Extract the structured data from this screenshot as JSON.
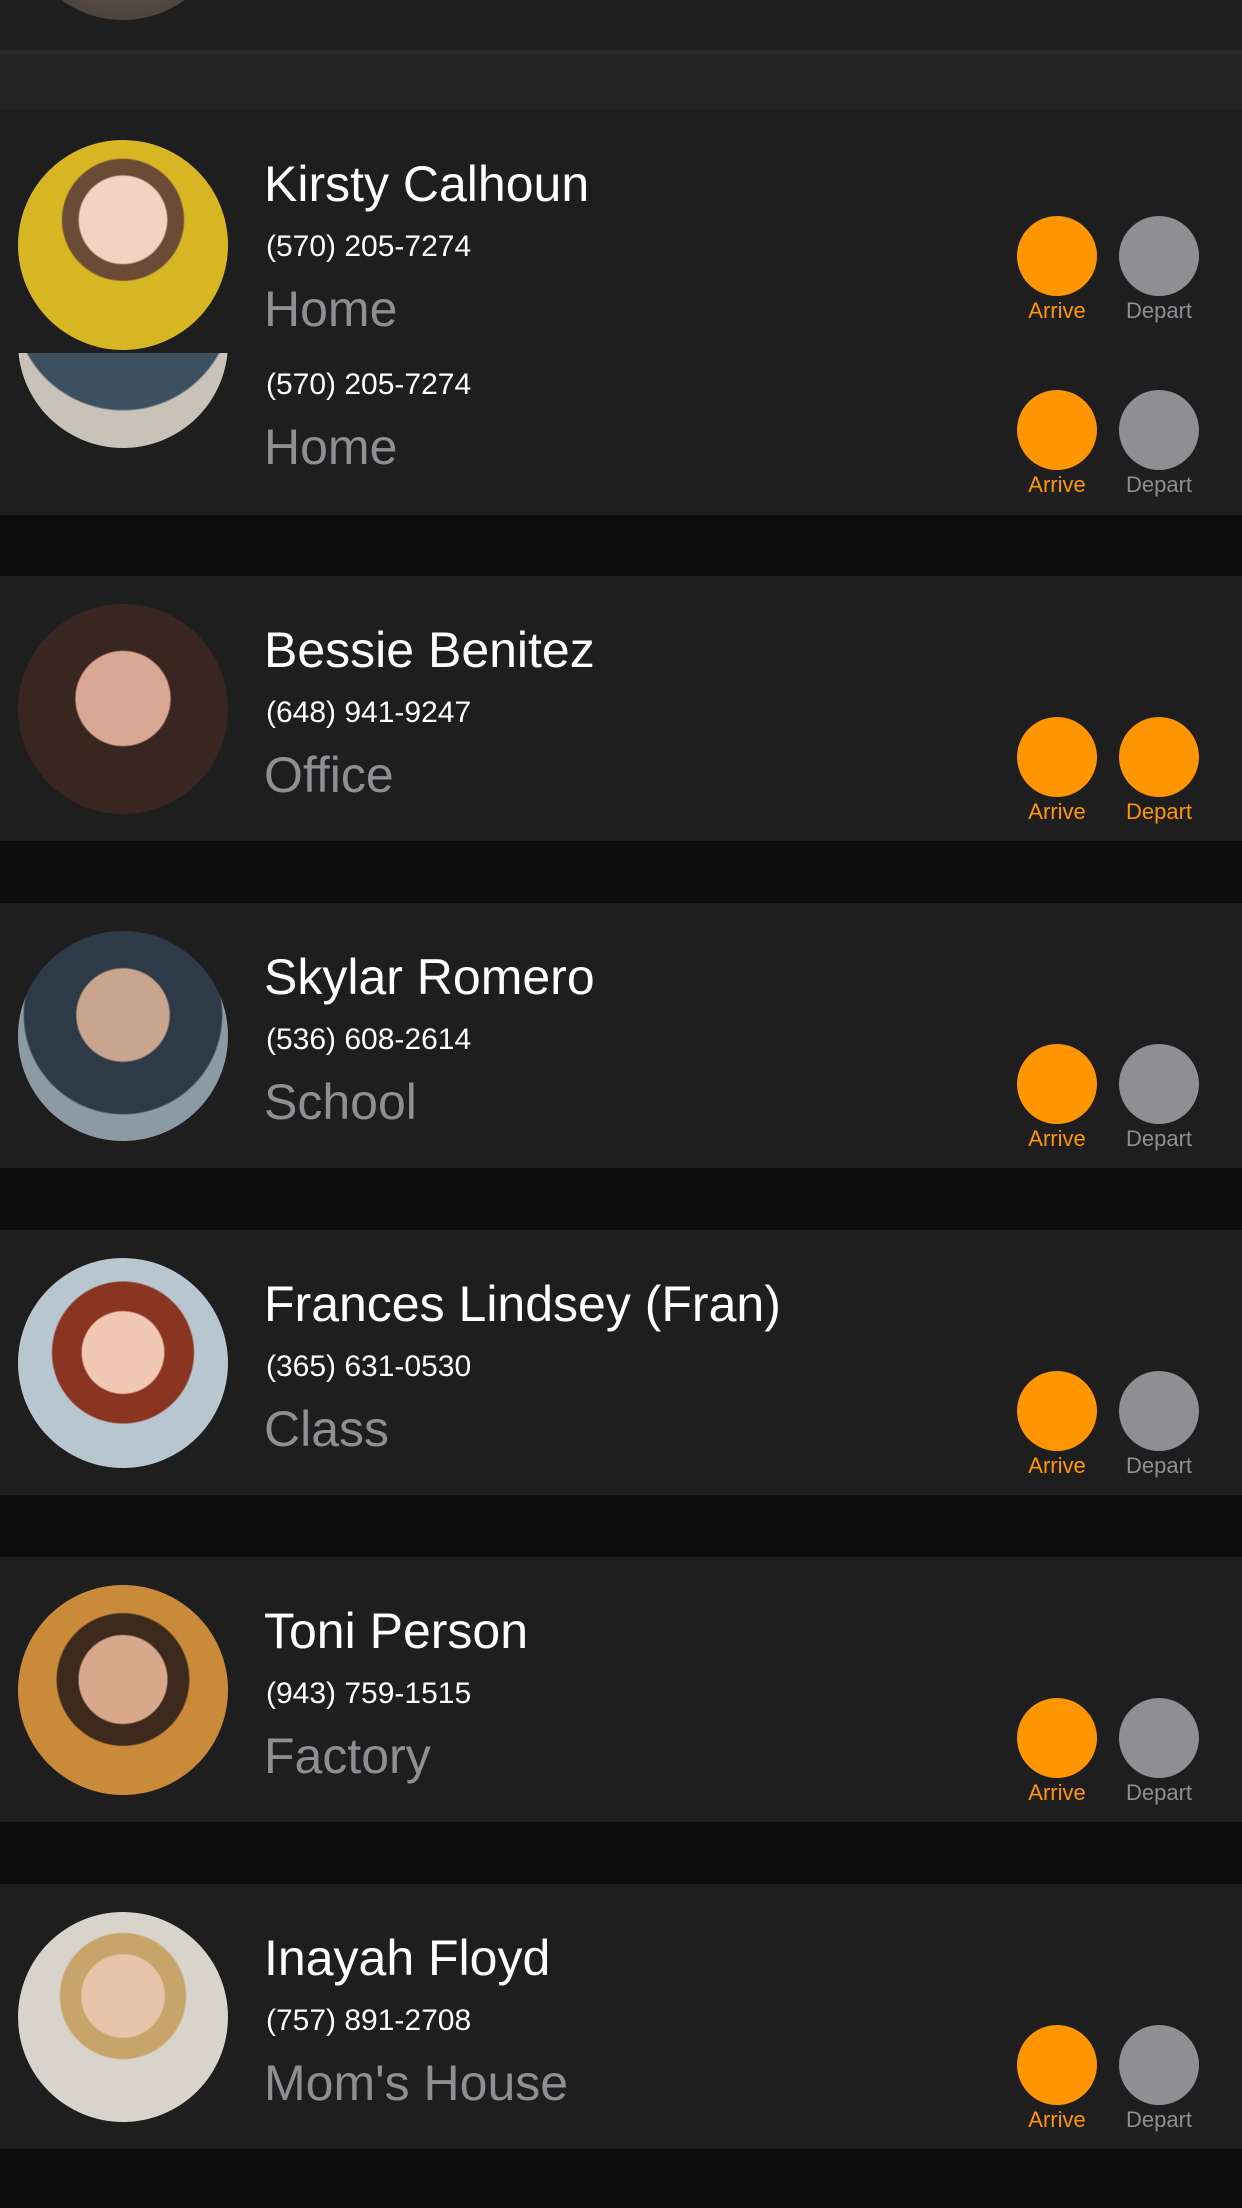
{
  "colors": {
    "accent": "#ff9500",
    "inactive": "#8e8e93",
    "card": "#1e1e1e",
    "background": "#0d0d0d"
  },
  "labels": {
    "arrive": "Arrive",
    "depart": "Depart"
  },
  "contacts": [
    {
      "name": "Kirsty Calhoun",
      "phone": "(570) 205-7274",
      "location": "Home",
      "arrive": true,
      "depart": false
    },
    {
      "name": "",
      "phone": "(570) 205-7274",
      "location": "Home",
      "arrive": true,
      "depart": false
    },
    {
      "name": "Bessie Benitez",
      "phone": "(648) 941-9247",
      "location": "Office",
      "arrive": true,
      "depart": true
    },
    {
      "name": "Skylar Romero",
      "phone": "(536) 608-2614",
      "location": "School",
      "arrive": true,
      "depart": false
    },
    {
      "name": "Frances Lindsey (Fran)",
      "phone": "(365) 631-0530",
      "location": "Class",
      "arrive": true,
      "depart": false
    },
    {
      "name": "Toni Person",
      "phone": "(943) 759-1515",
      "location": "Factory",
      "arrive": true,
      "depart": false
    },
    {
      "name": "Inayah Floyd",
      "phone": "(757) 891-2708",
      "location": "Mom's House",
      "arrive": true,
      "depart": false
    }
  ]
}
